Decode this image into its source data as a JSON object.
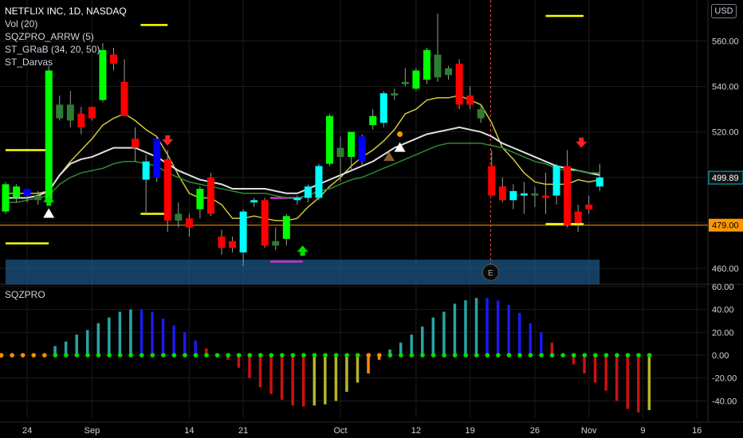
{
  "header": {
    "title": "NETFLIX INC, 1D, NASDAQ",
    "indicators": [
      "Vol (20)",
      "SQZPRO_ARRW (5)",
      "ST_GRaB (34, 20, 50)",
      "ST_Darvas"
    ],
    "currency": "USD"
  },
  "lower_panel": {
    "title": "SQZPRO"
  },
  "event_marker": "E",
  "colors": {
    "background": "#000000",
    "grid": "#1c1c1c",
    "bull_candle": "#00ff00",
    "bear_candle": "#ff0000",
    "cyan_candle": "#00ffff",
    "blue_candle": "#0000ff",
    "yellow": "#ffff00",
    "magenta": "#cc33cc",
    "support_line": "#ff9800",
    "price_tag_fill": "#00bcd4",
    "volume": "#1e5a8c"
  },
  "chart_data": [
    {
      "type": "candlestick",
      "symbol": "NETFLIX INC",
      "timeframe": "1D",
      "exchange": "NASDAQ",
      "x_ticks": [
        "24",
        "Sep",
        "14",
        "21",
        "Oct",
        "12",
        "19",
        "26",
        "Nov",
        "9",
        "16"
      ],
      "y_ticks": [
        460,
        480,
        500,
        520,
        540,
        560
      ],
      "y_range": [
        453,
        578
      ],
      "last_price": "499.89",
      "level_label": "479.00",
      "candles": [
        {
          "o": 485,
          "h": 498,
          "l": 484,
          "c": 497,
          "color": "lime"
        },
        {
          "o": 491,
          "h": 497,
          "l": 489,
          "c": 496,
          "color": "lime"
        },
        {
          "o": 492,
          "h": 495,
          "l": 489,
          "c": 495,
          "color": "blue"
        },
        {
          "o": 492,
          "h": 494,
          "l": 488,
          "c": 490,
          "color": "green"
        },
        {
          "o": 489,
          "h": 549,
          "l": 488,
          "c": 547,
          "color": "lime"
        },
        {
          "o": 532,
          "h": 536,
          "l": 525,
          "c": 526,
          "color": "green"
        },
        {
          "o": 525,
          "h": 538,
          "l": 522,
          "c": 532,
          "color": "green"
        },
        {
          "o": 528,
          "h": 531,
          "l": 519,
          "c": 522,
          "color": "red"
        },
        {
          "o": 531,
          "h": 531,
          "l": 525,
          "c": 526,
          "color": "red"
        },
        {
          "o": 534,
          "h": 559,
          "l": 533,
          "c": 556,
          "color": "lime"
        },
        {
          "o": 554,
          "h": 557,
          "l": 547,
          "c": 550,
          "color": "red"
        },
        {
          "o": 542,
          "h": 552,
          "l": 527,
          "c": 527,
          "color": "red"
        },
        {
          "o": 517,
          "h": 522,
          "l": 507,
          "c": 513,
          "color": "red"
        },
        {
          "o": 499,
          "h": 510,
          "l": 484,
          "c": 507,
          "color": "cyan"
        },
        {
          "o": 500,
          "h": 518,
          "l": 498,
          "c": 517,
          "color": "blue"
        },
        {
          "o": 508,
          "h": 512,
          "l": 476,
          "c": 481,
          "color": "red"
        },
        {
          "o": 481,
          "h": 489,
          "l": 478,
          "c": 484,
          "color": "green"
        },
        {
          "o": 482,
          "h": 484,
          "l": 474,
          "c": 478,
          "color": "red"
        },
        {
          "o": 486,
          "h": 496,
          "l": 482,
          "c": 495,
          "color": "lime"
        },
        {
          "o": 500,
          "h": 502,
          "l": 483,
          "c": 484,
          "color": "red"
        },
        {
          "o": 474,
          "h": 477,
          "l": 466,
          "c": 469,
          "color": "red"
        },
        {
          "o": 472,
          "h": 474,
          "l": 467,
          "c": 469,
          "color": "red"
        },
        {
          "o": 467,
          "h": 486,
          "l": 461,
          "c": 485,
          "color": "cyan"
        },
        {
          "o": 489,
          "h": 491,
          "l": 487,
          "c": 490,
          "color": "cyan"
        },
        {
          "o": 490,
          "h": 491,
          "l": 469,
          "c": 470,
          "color": "red"
        },
        {
          "o": 470,
          "h": 478,
          "l": 468,
          "c": 472,
          "color": "green"
        },
        {
          "o": 473,
          "h": 484,
          "l": 470,
          "c": 483,
          "color": "lime"
        },
        {
          "o": 490,
          "h": 492,
          "l": 488,
          "c": 491,
          "color": "cyan"
        },
        {
          "o": 491,
          "h": 497,
          "l": 489,
          "c": 496,
          "color": "cyan"
        },
        {
          "o": 491,
          "h": 506,
          "l": 490,
          "c": 505,
          "color": "cyan"
        },
        {
          "o": 506,
          "h": 528,
          "l": 505,
          "c": 527,
          "color": "lime"
        },
        {
          "o": 513,
          "h": 518,
          "l": 498,
          "c": 509,
          "color": "green"
        },
        {
          "o": 509,
          "h": 520,
          "l": 503,
          "c": 520,
          "color": "lime"
        },
        {
          "o": 518,
          "h": 519,
          "l": 505,
          "c": 507,
          "color": "blue"
        },
        {
          "o": 523,
          "h": 530,
          "l": 521,
          "c": 527,
          "color": "lime"
        },
        {
          "o": 524,
          "h": 538,
          "l": 522,
          "c": 537,
          "color": "cyan"
        },
        {
          "o": 536,
          "h": 539,
          "l": 534,
          "c": 537,
          "color": "green"
        },
        {
          "o": 541,
          "h": 548,
          "l": 540,
          "c": 542,
          "color": "green"
        },
        {
          "o": 539,
          "h": 548,
          "l": 538,
          "c": 547,
          "color": "lime"
        },
        {
          "o": 543,
          "h": 557,
          "l": 541,
          "c": 556,
          "color": "lime"
        },
        {
          "o": 554,
          "h": 572,
          "l": 542,
          "c": 544,
          "color": "green"
        },
        {
          "o": 545,
          "h": 549,
          "l": 543,
          "c": 548,
          "color": "green"
        },
        {
          "o": 550,
          "h": 552,
          "l": 530,
          "c": 532,
          "color": "red"
        },
        {
          "o": 536,
          "h": 540,
          "l": 530,
          "c": 532,
          "color": "red"
        },
        {
          "o": 530,
          "h": 532,
          "l": 524,
          "c": 526,
          "color": "green"
        },
        {
          "o": 505,
          "h": 512,
          "l": 492,
          "c": 492,
          "color": "red"
        },
        {
          "o": 496,
          "h": 500,
          "l": 489,
          "c": 490,
          "color": "red"
        },
        {
          "o": 490,
          "h": 497,
          "l": 486,
          "c": 494,
          "color": "cyan"
        },
        {
          "o": 492,
          "h": 498,
          "l": 484,
          "c": 493,
          "color": "cyan"
        },
        {
          "o": 493,
          "h": 496,
          "l": 487,
          "c": 492,
          "color": "green"
        },
        {
          "o": 492,
          "h": 502,
          "l": 484,
          "c": 491,
          "color": "red"
        },
        {
          "o": 492,
          "h": 506,
          "l": 488,
          "c": 505,
          "color": "cyan"
        },
        {
          "o": 505,
          "h": 512,
          "l": 478,
          "c": 479,
          "color": "red"
        },
        {
          "o": 480,
          "h": 488,
          "l": 476,
          "c": 485,
          "color": "red"
        },
        {
          "o": 486,
          "h": 492,
          "l": 484,
          "c": 488,
          "color": "red"
        },
        {
          "o": 496,
          "h": 506,
          "l": 494,
          "c": 500,
          "color": "cyan"
        }
      ],
      "lines": [
        {
          "name": "fast",
          "color": "yellow",
          "values": [
            493,
            493,
            493,
            493,
            494,
            501,
            507,
            512,
            517,
            523,
            526,
            528,
            525,
            521,
            518,
            510,
            501,
            493,
            491,
            491,
            488,
            482,
            482,
            483,
            482,
            481,
            481,
            482,
            487,
            491,
            496,
            500,
            505,
            509,
            512,
            516,
            521,
            528,
            530,
            534,
            535,
            535,
            536,
            534,
            532,
            524,
            513,
            508,
            502,
            498,
            497,
            497,
            497,
            499,
            498,
            499
          ]
        },
        {
          "name": "slow",
          "color": "white",
          "values": [
            491,
            491,
            491,
            492,
            494,
            501,
            506,
            508,
            509,
            511,
            513,
            513,
            513,
            511,
            509,
            506,
            503,
            501,
            499,
            498,
            497,
            495,
            495,
            495,
            495,
            494,
            493,
            493,
            495,
            497,
            499,
            501,
            503,
            505,
            507,
            510,
            513,
            515,
            517,
            519,
            520,
            521,
            522,
            521,
            520,
            518,
            515,
            513,
            511,
            509,
            507,
            505,
            504,
            503,
            502,
            501
          ]
        },
        {
          "name": "green",
          "color": "green",
          "values": [
            489,
            489,
            490,
            491,
            492,
            497,
            500,
            502,
            503,
            504,
            506,
            507,
            507,
            506,
            505,
            502,
            500,
            498,
            497,
            496,
            495,
            494,
            493,
            493,
            493,
            492,
            491,
            491,
            492,
            494,
            495,
            497,
            499,
            500,
            502,
            504,
            506,
            508,
            510,
            512,
            514,
            515,
            515,
            515,
            515,
            514,
            513,
            511,
            509,
            507,
            506,
            504,
            503,
            503,
            502,
            502
          ]
        }
      ],
      "volume": [
        1,
        1,
        1,
        1,
        1,
        1,
        1,
        1,
        1,
        1,
        1,
        1,
        1,
        1,
        1,
        1,
        1,
        1,
        1,
        1,
        1,
        1,
        1,
        1,
        1,
        1,
        1,
        1,
        1,
        1,
        1,
        1,
        1,
        1,
        1,
        1,
        1,
        1,
        1,
        1,
        1,
        1,
        1,
        1,
        1,
        1,
        1,
        1,
        1,
        1,
        1,
        1,
        1,
        1,
        1,
        1
      ]
    },
    {
      "type": "bar",
      "name": "SQZPRO",
      "y_ticks": [
        60,
        40,
        20,
        0,
        -20,
        -40
      ],
      "y_range": [
        -55,
        62
      ],
      "values": [
        -2,
        -1,
        -1,
        0,
        0,
        8,
        12,
        18,
        22,
        28,
        33,
        38,
        40,
        40,
        38,
        32,
        26,
        20,
        13,
        6,
        0,
        -4,
        -11,
        -20,
        -28,
        -34,
        -39,
        -44,
        -45,
        -44,
        -43,
        -40,
        -32,
        -24,
        -16,
        -4,
        5,
        11,
        18,
        25,
        33,
        38,
        45,
        48,
        50,
        50,
        48,
        44,
        37,
        28,
        20,
        11,
        0,
        -8,
        -16,
        -24,
        -31,
        -40,
        -47,
        -50,
        -48
      ],
      "bar_colors": [
        "orange",
        "orange",
        "orange",
        "orange",
        "orange",
        "teal",
        "teal",
        "teal",
        "teal",
        "teal",
        "teal",
        "teal",
        "teal",
        "blue",
        "blue",
        "blue",
        "blue",
        "blue",
        "blue",
        "red",
        "red",
        "red",
        "red",
        "red",
        "red",
        "red",
        "red",
        "red",
        "red",
        "olive",
        "olive",
        "olive",
        "olive",
        "olive",
        "orange",
        "orange",
        "teal",
        "teal",
        "teal",
        "teal",
        "teal",
        "teal",
        "teal",
        "teal",
        "teal",
        "blue",
        "blue",
        "blue",
        "blue",
        "blue",
        "blue",
        "red",
        "red",
        "red",
        "red",
        "red",
        "red",
        "red",
        "red",
        "red",
        "olive"
      ]
    }
  ]
}
